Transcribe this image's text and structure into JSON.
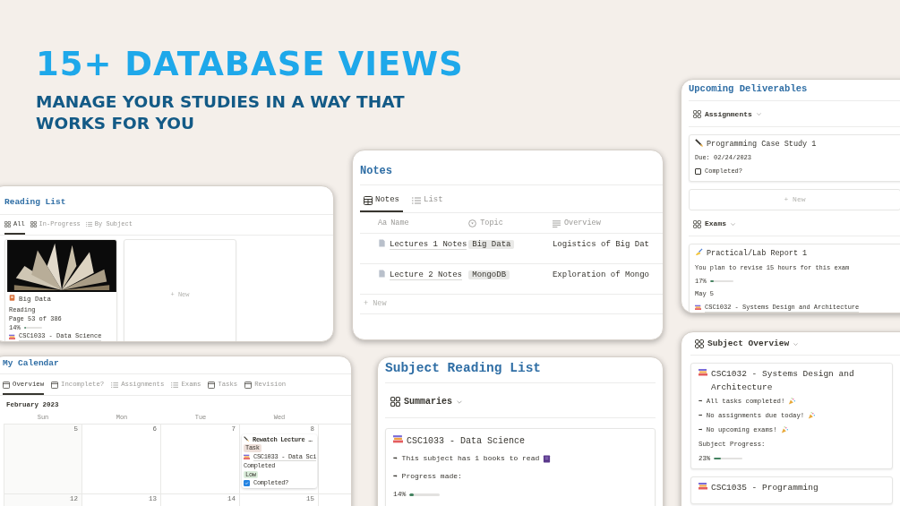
{
  "headline": "15+ DATABASE VIEWS",
  "subheadline": "MANAGE YOUR STUDIES IN A WAY THAT WORKS FOR YOU",
  "reading_list": {
    "title": "Reading List",
    "tabs": [
      {
        "label": "All",
        "kind": "gallery",
        "selected": true
      },
      {
        "label": "In-Progress",
        "kind": "gallery",
        "selected": false
      },
      {
        "label": "By Subject",
        "kind": "list",
        "selected": false
      }
    ],
    "cards": [
      {
        "kind": "book",
        "title": "Big Data",
        "fields": [
          {
            "kind": "text",
            "text": "Reading"
          },
          {
            "kind": "text",
            "text": "Page 53 of 386"
          },
          {
            "kind": "progress",
            "reading": "14%",
            "level": 0.14
          },
          {
            "kind": "relation",
            "text": "CSC1033 - Data Science"
          }
        ]
      },
      {
        "kind": "new",
        "label": "+ New"
      }
    ]
  },
  "notes": {
    "title": "Notes",
    "tabs": [
      {
        "label": "Notes",
        "kind": "table",
        "selected": true
      },
      {
        "label": "List",
        "kind": "list",
        "selected": false
      }
    ],
    "columns": [
      {
        "kind": "title",
        "prefix": "Aa",
        "label": "Name"
      },
      {
        "kind": "select",
        "label": "Topic"
      },
      {
        "kind": "text",
        "label": "Overview"
      }
    ],
    "rows": [
      {
        "name": "Lectures 1 Notes",
        "topic": "Big Data",
        "overview": "Logistics of Big Dat"
      },
      {
        "name": "Lecture 2 Notes",
        "topic": "MongoDB",
        "overview": "Exploration of Mongo"
      }
    ],
    "new": "+ New"
  },
  "deliverables": {
    "title": "Upcoming Deliverables",
    "groups": [
      {
        "name": "Assignments",
        "cards": [
          {
            "kind": "assignment",
            "title": "Programming Case Study 1",
            "fields": [
              {
                "kind": "text",
                "text": "Due: 02/24/2023"
              },
              {
                "kind": "checkbox",
                "label": "Completed?",
                "checked": false
              }
            ]
          }
        ],
        "new": "+ New"
      },
      {
        "name": "Exams",
        "cards": [
          {
            "kind": "exam",
            "title": "Practical/Lab Report 1",
            "fields": [
              {
                "kind": "text",
                "text": "You plan to revise 15 hours for this exam"
              },
              {
                "kind": "progress",
                "reading": "17%",
                "level": 0.17
              },
              {
                "kind": "text",
                "text": "May 5"
              },
              {
                "kind": "relation",
                "text": "CSC1032 - Systems Design and Architecture"
              }
            ]
          }
        ]
      }
    ]
  },
  "calendar": {
    "title": "My Calendar",
    "tabs": [
      {
        "label": "Overview",
        "kind": "calendar",
        "selected": true
      },
      {
        "label": "Incomplete?",
        "kind": "calendar",
        "selected": false
      },
      {
        "label": "Assignments",
        "kind": "list",
        "selected": false
      },
      {
        "label": "Exams",
        "kind": "list",
        "selected": false
      },
      {
        "label": "Tasks",
        "kind": "calendar",
        "selected": false
      },
      {
        "label": "Revision",
        "kind": "calendar",
        "selected": false
      }
    ],
    "month": "February 2023",
    "weekdays": [
      "Sun",
      "Mon",
      "Tue",
      "Wed"
    ],
    "weeks": [
      [
        {
          "day": "5"
        },
        {
          "day": "6"
        },
        {
          "day": "7"
        },
        {
          "day": "8",
          "events": [
            {
              "kind": "task",
              "title": "Rewatch Lecture …",
              "fields": [
                {
                  "kind": "tag",
                  "text": "Task",
                  "color": "#eee0da"
                },
                {
                  "kind": "relation",
                  "text": "CSC1033 - Data Sci"
                },
                {
                  "kind": "text",
                  "text": "Completed"
                },
                {
                  "kind": "tag",
                  "text": "Low",
                  "color": "#dbeddb"
                },
                {
                  "kind": "checkbox",
                  "label": "Completed?",
                  "checked": true
                }
              ]
            }
          ]
        }
      ],
      [
        {
          "day": "12"
        },
        {
          "day": "13"
        },
        {
          "day": "14"
        },
        {
          "day": "15"
        }
      ]
    ]
  },
  "subject_reading": {
    "title": "Subject Reading List",
    "view": "Summaries",
    "cards": [
      {
        "kind": "subject",
        "title": "CSC1033 - Data Science",
        "fields": [
          {
            "kind": "booknote",
            "text": "➡ This subject has 1 books to read"
          },
          {
            "kind": "text",
            "text": "➡ Progress made:"
          },
          {
            "kind": "progress",
            "reading": "14%",
            "level": 0.14
          }
        ]
      }
    ]
  },
  "subject_overview": {
    "view": "Subject Overview",
    "cards": [
      {
        "kind": "subject",
        "title": "CSC1032 - Systems Design and Architecture",
        "fields": [
          {
            "kind": "cheer",
            "text": "➡ All tasks completed!"
          },
          {
            "kind": "cheer",
            "text": "➡ No assignments due today!"
          },
          {
            "kind": "cheer",
            "text": "➡ No upcoming exams!"
          },
          {
            "kind": "text",
            "text": "Subject Progress:"
          },
          {
            "kind": "progress",
            "reading": "23%",
            "level": 0.23
          }
        ]
      },
      {
        "kind": "subject",
        "title": "CSC1035 - Programming"
      }
    ]
  }
}
